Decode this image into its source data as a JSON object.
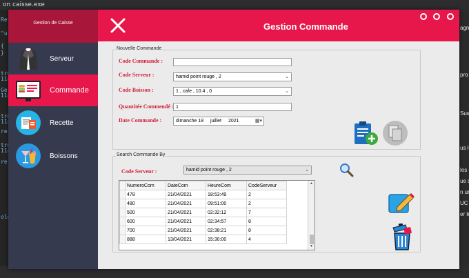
{
  "background": {
    "top_text": "on caisse.exe",
    "left_lines": [
      "Re",
      "\"u",
      "{",
      "}",
      "tren",
      "11c",
      "Ge",
      "11c",
      "tren",
      "11c",
      "re",
      "tren",
      "11c",
      "re",
      "olén"
    ],
    "right_lines": [
      "agne",
      "pro",
      "Sus le",
      "us le",
      "les é",
      "ue sa",
      "n uni",
      "UC",
      "er le"
    ]
  },
  "sidebar": {
    "app_title": "Gestion de Caisse",
    "items": [
      {
        "label": "Serveur"
      },
      {
        "label": "Commande"
      },
      {
        "label": "Recette"
      },
      {
        "label": "Boissons"
      }
    ]
  },
  "header": {
    "title": "Gestion Commande"
  },
  "nouvelle_commande": {
    "group_title": "Nouvelle Commande",
    "code_commande_label": "Code Commande :",
    "code_commande_value": "",
    "code_serveur_label": "Code Serveur :",
    "code_serveur_value": "hamid point rouge , 2",
    "code_boisson_label": "Code Boisson :",
    "code_boisson_value": "1 , cafe , 10.4 , 0",
    "quantite_label": "Quantitée Commendé :",
    "quantite_value": "1",
    "date_label": "Date Commande :",
    "date_day": "dimanche 18",
    "date_month": "juillet",
    "date_year": "2021"
  },
  "search": {
    "group_title": "Search Commande By",
    "code_serveur_label": "Code Serveur :",
    "code_serveur_value": "hamid point rouge , 2",
    "columns": [
      "NumeroCom",
      "DateCom",
      "HeureCom",
      "CodeServeur"
    ],
    "rows": [
      [
        "478",
        "21/04/2021",
        "18:53:49",
        "2"
      ],
      [
        "480",
        "21/04/2021",
        "09:51:00",
        "2"
      ],
      [
        "500",
        "21/04/2021",
        "02:32:12",
        "7"
      ],
      [
        "600",
        "21/04/2021",
        "02:34:57",
        "8"
      ],
      [
        "700",
        "21/04/2021",
        "02:38:21",
        "8"
      ],
      [
        "888",
        "13/04/2021",
        "15:30:00",
        "4"
      ]
    ]
  },
  "colors": {
    "accent": "#e8174b",
    "sidebar": "#353a4f",
    "header_dark": "#a8163a",
    "label_red": "#d11f3a"
  }
}
